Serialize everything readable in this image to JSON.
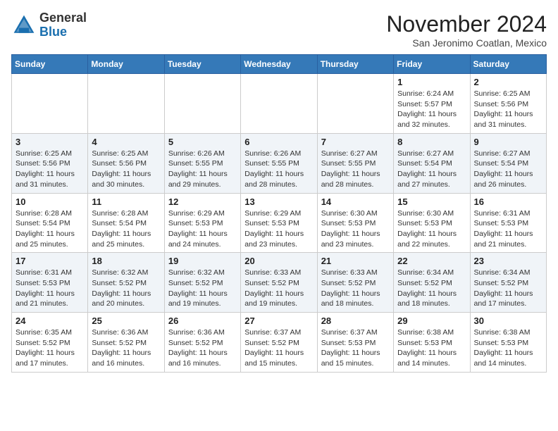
{
  "header": {
    "logo_general": "General",
    "logo_blue": "Blue",
    "month_year": "November 2024",
    "location": "San Jeronimo Coatlan, Mexico"
  },
  "weekdays": [
    "Sunday",
    "Monday",
    "Tuesday",
    "Wednesday",
    "Thursday",
    "Friday",
    "Saturday"
  ],
  "weeks": [
    [
      {
        "day": "",
        "info": ""
      },
      {
        "day": "",
        "info": ""
      },
      {
        "day": "",
        "info": ""
      },
      {
        "day": "",
        "info": ""
      },
      {
        "day": "",
        "info": ""
      },
      {
        "day": "1",
        "info": "Sunrise: 6:24 AM\nSunset: 5:57 PM\nDaylight: 11 hours\nand 32 minutes."
      },
      {
        "day": "2",
        "info": "Sunrise: 6:25 AM\nSunset: 5:56 PM\nDaylight: 11 hours\nand 31 minutes."
      }
    ],
    [
      {
        "day": "3",
        "info": "Sunrise: 6:25 AM\nSunset: 5:56 PM\nDaylight: 11 hours\nand 31 minutes."
      },
      {
        "day": "4",
        "info": "Sunrise: 6:25 AM\nSunset: 5:56 PM\nDaylight: 11 hours\nand 30 minutes."
      },
      {
        "day": "5",
        "info": "Sunrise: 6:26 AM\nSunset: 5:55 PM\nDaylight: 11 hours\nand 29 minutes."
      },
      {
        "day": "6",
        "info": "Sunrise: 6:26 AM\nSunset: 5:55 PM\nDaylight: 11 hours\nand 28 minutes."
      },
      {
        "day": "7",
        "info": "Sunrise: 6:27 AM\nSunset: 5:55 PM\nDaylight: 11 hours\nand 28 minutes."
      },
      {
        "day": "8",
        "info": "Sunrise: 6:27 AM\nSunset: 5:54 PM\nDaylight: 11 hours\nand 27 minutes."
      },
      {
        "day": "9",
        "info": "Sunrise: 6:27 AM\nSunset: 5:54 PM\nDaylight: 11 hours\nand 26 minutes."
      }
    ],
    [
      {
        "day": "10",
        "info": "Sunrise: 6:28 AM\nSunset: 5:54 PM\nDaylight: 11 hours\nand 25 minutes."
      },
      {
        "day": "11",
        "info": "Sunrise: 6:28 AM\nSunset: 5:54 PM\nDaylight: 11 hours\nand 25 minutes."
      },
      {
        "day": "12",
        "info": "Sunrise: 6:29 AM\nSunset: 5:53 PM\nDaylight: 11 hours\nand 24 minutes."
      },
      {
        "day": "13",
        "info": "Sunrise: 6:29 AM\nSunset: 5:53 PM\nDaylight: 11 hours\nand 23 minutes."
      },
      {
        "day": "14",
        "info": "Sunrise: 6:30 AM\nSunset: 5:53 PM\nDaylight: 11 hours\nand 23 minutes."
      },
      {
        "day": "15",
        "info": "Sunrise: 6:30 AM\nSunset: 5:53 PM\nDaylight: 11 hours\nand 22 minutes."
      },
      {
        "day": "16",
        "info": "Sunrise: 6:31 AM\nSunset: 5:53 PM\nDaylight: 11 hours\nand 21 minutes."
      }
    ],
    [
      {
        "day": "17",
        "info": "Sunrise: 6:31 AM\nSunset: 5:53 PM\nDaylight: 11 hours\nand 21 minutes."
      },
      {
        "day": "18",
        "info": "Sunrise: 6:32 AM\nSunset: 5:52 PM\nDaylight: 11 hours\nand 20 minutes."
      },
      {
        "day": "19",
        "info": "Sunrise: 6:32 AM\nSunset: 5:52 PM\nDaylight: 11 hours\nand 19 minutes."
      },
      {
        "day": "20",
        "info": "Sunrise: 6:33 AM\nSunset: 5:52 PM\nDaylight: 11 hours\nand 19 minutes."
      },
      {
        "day": "21",
        "info": "Sunrise: 6:33 AM\nSunset: 5:52 PM\nDaylight: 11 hours\nand 18 minutes."
      },
      {
        "day": "22",
        "info": "Sunrise: 6:34 AM\nSunset: 5:52 PM\nDaylight: 11 hours\nand 18 minutes."
      },
      {
        "day": "23",
        "info": "Sunrise: 6:34 AM\nSunset: 5:52 PM\nDaylight: 11 hours\nand 17 minutes."
      }
    ],
    [
      {
        "day": "24",
        "info": "Sunrise: 6:35 AM\nSunset: 5:52 PM\nDaylight: 11 hours\nand 17 minutes."
      },
      {
        "day": "25",
        "info": "Sunrise: 6:36 AM\nSunset: 5:52 PM\nDaylight: 11 hours\nand 16 minutes."
      },
      {
        "day": "26",
        "info": "Sunrise: 6:36 AM\nSunset: 5:52 PM\nDaylight: 11 hours\nand 16 minutes."
      },
      {
        "day": "27",
        "info": "Sunrise: 6:37 AM\nSunset: 5:52 PM\nDaylight: 11 hours\nand 15 minutes."
      },
      {
        "day": "28",
        "info": "Sunrise: 6:37 AM\nSunset: 5:53 PM\nDaylight: 11 hours\nand 15 minutes."
      },
      {
        "day": "29",
        "info": "Sunrise: 6:38 AM\nSunset: 5:53 PM\nDaylight: 11 hours\nand 14 minutes."
      },
      {
        "day": "30",
        "info": "Sunrise: 6:38 AM\nSunset: 5:53 PM\nDaylight: 11 hours\nand 14 minutes."
      }
    ]
  ]
}
